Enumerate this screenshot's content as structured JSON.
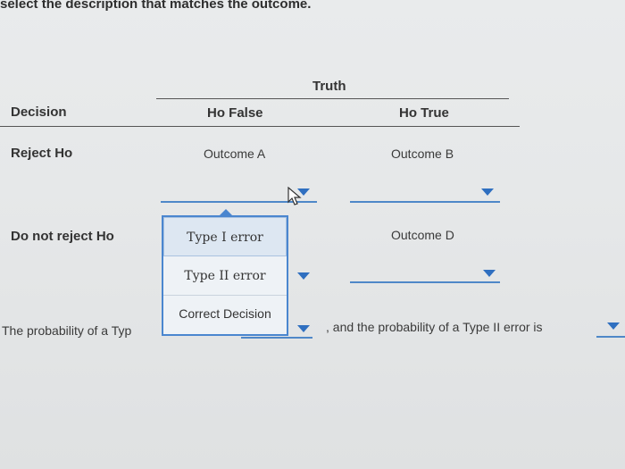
{
  "instruction": "select the description that matches the outcome.",
  "table": {
    "truth_label": "Truth",
    "decision_label": "Decision",
    "h0_false_label": "Ho False",
    "h0_true_label": "Ho True",
    "rows": [
      {
        "label": "Reject Ho",
        "cells": [
          "Outcome A",
          "Outcome B"
        ]
      },
      {
        "label": "Do not reject Ho",
        "cells": [
          "",
          "Outcome D"
        ]
      }
    ]
  },
  "dropdown": {
    "options": [
      "Type I error",
      "Type II error",
      "Correct Decision"
    ],
    "highlighted": "Type I error"
  },
  "sentence": {
    "part1": "The probability of a Typ",
    "part2": ", and the probability of a Type II error is"
  },
  "colors": {
    "accent": "#4f88c8",
    "arrow": "#2f6fc0"
  }
}
